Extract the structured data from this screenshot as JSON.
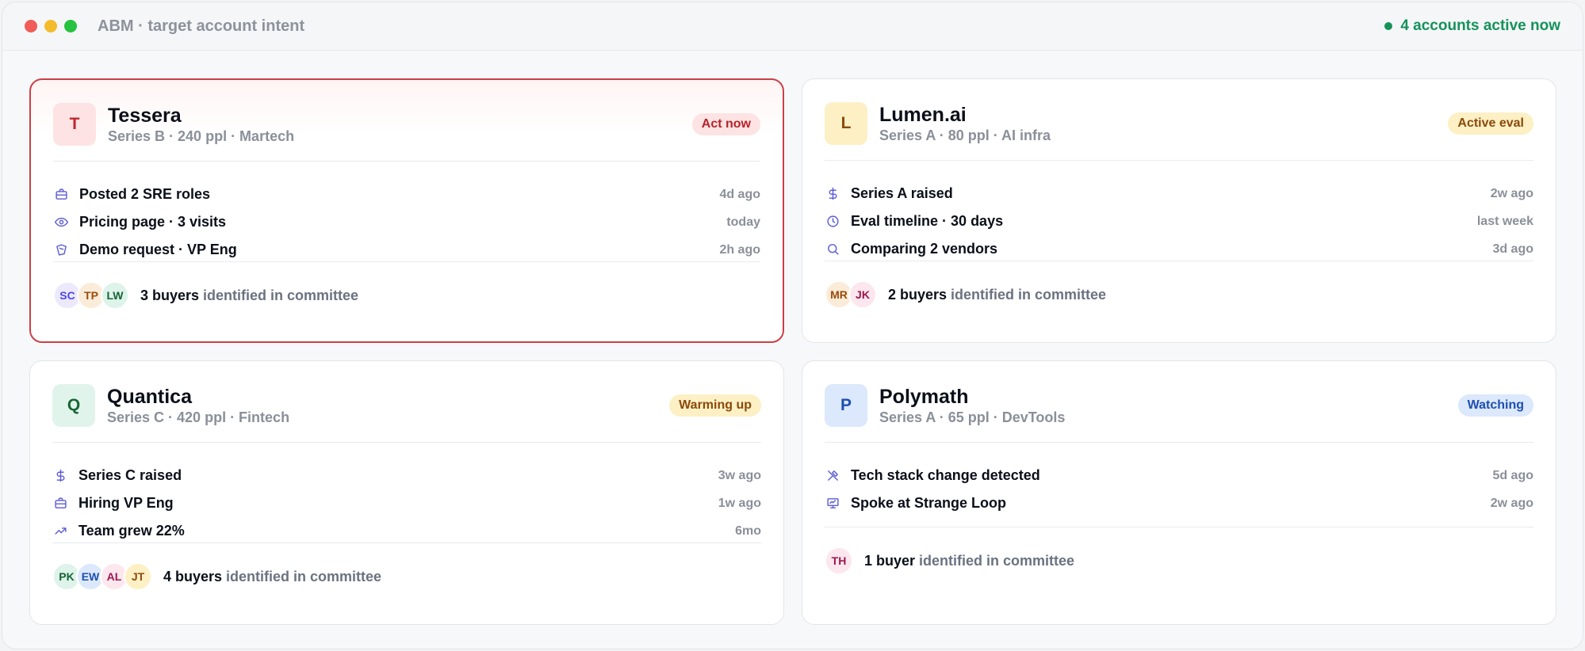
{
  "window": {
    "title": "ABM · target account intent",
    "status": "4 accounts active now"
  },
  "accounts": [
    {
      "initial": "T",
      "name": "Tessera",
      "meta": "Series B · 240 ppl · Martech",
      "badge": "Act now",
      "signals": [
        {
          "icon": "briefcase-icon",
          "text": "Posted 2 SRE roles",
          "time": "4d ago"
        },
        {
          "icon": "eye-icon",
          "text": "Pricing page · 3 visits",
          "time": "today"
        },
        {
          "icon": "hand-icon",
          "text": "Demo request · VP Eng",
          "time": "2h ago"
        }
      ],
      "buyers": [
        "SC",
        "TP",
        "LW"
      ],
      "committee_count": "3 buyers",
      "committee_text": " identified in committee"
    },
    {
      "initial": "L",
      "name": "Lumen.ai",
      "meta": "Series A · 80 ppl · AI infra",
      "badge": "Active eval",
      "signals": [
        {
          "icon": "dollar-icon",
          "text": "Series A raised",
          "time": "2w ago"
        },
        {
          "icon": "clock-icon",
          "text": "Eval timeline · 30 days",
          "time": "last week"
        },
        {
          "icon": "search-icon",
          "text": "Comparing 2 vendors",
          "time": "3d ago"
        }
      ],
      "buyers": [
        "MR",
        "JK"
      ],
      "committee_count": "2 buyers",
      "committee_text": " identified in committee"
    },
    {
      "initial": "Q",
      "name": "Quantica",
      "meta": "Series C · 420 ppl · Fintech",
      "badge": "Warming up",
      "signals": [
        {
          "icon": "dollar-icon",
          "text": "Series C raised",
          "time": "3w ago"
        },
        {
          "icon": "briefcase-icon",
          "text": "Hiring VP Eng",
          "time": "1w ago"
        },
        {
          "icon": "trending-up-icon",
          "text": "Team grew 22%",
          "time": "6mo"
        }
      ],
      "buyers": [
        "PK",
        "EW",
        "AL",
        "JT"
      ],
      "committee_count": "4 buyers",
      "committee_text": " identified in committee"
    },
    {
      "initial": "P",
      "name": "Polymath",
      "meta": "Series A · 65 ppl · DevTools",
      "badge": "Watching",
      "signals": [
        {
          "icon": "tools-icon",
          "text": "Tech stack change detected",
          "time": "5d ago"
        },
        {
          "icon": "presentation-icon",
          "text": "Spoke at Strange Loop",
          "time": "2w ago"
        }
      ],
      "buyers": [
        "TH"
      ],
      "committee_count": "1 buyer",
      "committee_text": " identified in committee"
    }
  ],
  "colors": {
    "accent_icon": "#5b5bd6",
    "live_green": "#15925a",
    "badge_act_now": {
      "bg": "#fde3e3",
      "fg": "#b4232a"
    },
    "badge_active_eval": {
      "bg": "#fdf0c4",
      "fg": "#8a4a0b"
    },
    "badge_warming_up": {
      "bg": "#fdf0c4",
      "fg": "#8a4a0b"
    },
    "badge_watching": {
      "bg": "#dce8fb",
      "fg": "#1e4fb0"
    }
  }
}
